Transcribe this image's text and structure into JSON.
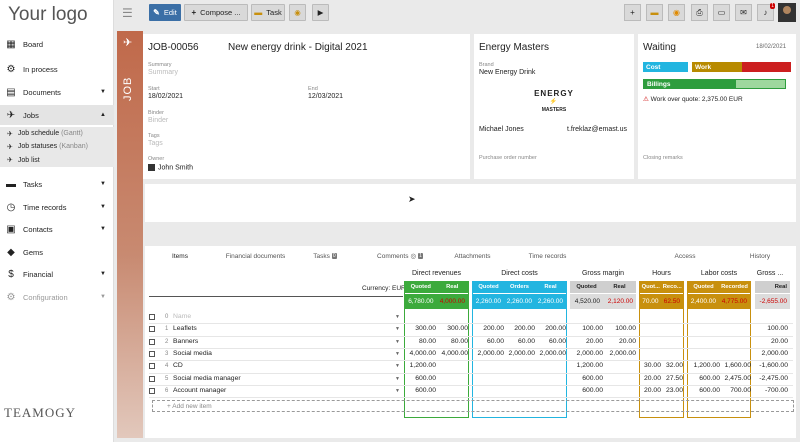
{
  "sidebar": {
    "logo": "Your logo",
    "items": [
      {
        "label": "Board",
        "icon": "grid-icon"
      },
      {
        "label": "In process",
        "icon": "flow-icon"
      },
      {
        "label": "Documents",
        "icon": "document-icon"
      },
      {
        "label": "Jobs",
        "icon": "rocket-icon"
      },
      {
        "label": "Tasks",
        "icon": "tasks-icon"
      },
      {
        "label": "Time records",
        "icon": "clock-icon"
      },
      {
        "label": "Contacts",
        "icon": "contacts-icon"
      },
      {
        "label": "Gems",
        "icon": "gem-icon"
      },
      {
        "label": "Financial",
        "icon": "dollar-icon"
      },
      {
        "label": "Configuration",
        "icon": "gear-icon"
      }
    ],
    "sub": [
      {
        "label": "Job schedule",
        "muted": "(Gantt)"
      },
      {
        "label": "Job statuses",
        "muted": "(Kanban)"
      },
      {
        "label": "Job list",
        "muted": ""
      }
    ],
    "brandmark": "TEAMOGY"
  },
  "toolbar": {
    "edit": "Edit",
    "compose": "Compose ...",
    "task": "Task"
  },
  "job": {
    "strip": "JOB",
    "number": "JOB-00056",
    "name": "New energy drink - Digital 2021",
    "summary_label": "Summary",
    "summary_ph": "Summary",
    "start_label": "Start",
    "start": "18/02/2021",
    "end_label": "End",
    "end": "12/03/2021",
    "binder_label": "Binder",
    "binder_ph": "Binder",
    "tags_label": "Tags",
    "tags_ph": "Tags",
    "owner_label": "Owner",
    "owner": "John Smith"
  },
  "client": {
    "name": "Energy Masters",
    "brand_label": "Brand",
    "brand": "New Energy Drink",
    "logo_top": "ENERGY",
    "logo_bottom": "MASTERS",
    "contact": "Michael Jones",
    "email": "t.freklaz@emast.us",
    "po_label": "Purchase order number"
  },
  "status": {
    "title": "Waiting",
    "date": "18/02/2021",
    "cost": "Cost",
    "work": "Work",
    "billings": "Billings",
    "warning": "Work over quote: 2,375.00 EUR",
    "closing": "Closing remarks"
  },
  "tabs": [
    {
      "label": "Items"
    },
    {
      "label": "Financial documents"
    },
    {
      "label": "Tasks",
      "badge": "0"
    },
    {
      "label": "Comments",
      "badge": "1"
    },
    {
      "label": "Attachments"
    },
    {
      "label": "Time records"
    },
    {
      "label": "Access"
    },
    {
      "label": "History"
    }
  ],
  "table": {
    "currency": "Currency: EUR",
    "groups": [
      "Direct revenues",
      "Direct costs",
      "Gross margin",
      "Hours",
      "Labor costs",
      "Gross ..."
    ],
    "sub": {
      "rev": [
        "Quoted",
        "Real"
      ],
      "cost": [
        "Quoted",
        "Orders",
        "Real"
      ],
      "gm": [
        "Quoted",
        "Real"
      ],
      "hours": [
        "Quot...",
        "Reco..."
      ],
      "labor": [
        "Quoted",
        "Recorded"
      ],
      "gross": [
        "Real"
      ]
    },
    "totals": {
      "rev": [
        "6,780.00",
        "4,000.00"
      ],
      "cost": [
        "2,260.00",
        "2,260.00",
        "2,260.00"
      ],
      "gm": [
        "4,520.00",
        "2,120.00"
      ],
      "hours": [
        "70.00",
        "62.50"
      ],
      "labor": [
        "2,400.00",
        "4,775.00"
      ],
      "gross": [
        "-2,655.00"
      ]
    },
    "rows": [
      {
        "num": "0",
        "name": "Name",
        "ph": true,
        "rev": [
          "",
          ""
        ],
        "cost": [
          "",
          "",
          ""
        ],
        "gm": [
          "",
          ""
        ],
        "hours": [
          "",
          ""
        ],
        "labor": [
          "",
          ""
        ],
        "gross": ""
      },
      {
        "num": "1",
        "name": "Leaflets",
        "rev": [
          "300.00",
          "300.00"
        ],
        "cost": [
          "200.00",
          "200.00",
          "200.00"
        ],
        "gm": [
          "100.00",
          "100.00"
        ],
        "hours": [
          "",
          ""
        ],
        "labor": [
          "",
          ""
        ],
        "gross": "100.00"
      },
      {
        "num": "2",
        "name": "Banners",
        "rev": [
          "80.00",
          "80.00"
        ],
        "cost": [
          "60.00",
          "60.00",
          "60.00"
        ],
        "gm": [
          "20.00",
          "20.00"
        ],
        "hours": [
          "",
          ""
        ],
        "labor": [
          "",
          ""
        ],
        "gross": "20.00"
      },
      {
        "num": "3",
        "name": "Social media",
        "rev": [
          "4,000.00",
          "4,000.00"
        ],
        "cost": [
          "2,000.00",
          "2,000.00",
          "2,000.00"
        ],
        "gm": [
          "2,000.00",
          "2,000.00"
        ],
        "hours": [
          "",
          ""
        ],
        "labor": [
          "",
          ""
        ],
        "gross": "2,000.00"
      },
      {
        "num": "4",
        "name": "CD",
        "rev": [
          "1,200.00",
          ""
        ],
        "cost": [
          "",
          "",
          ""
        ],
        "gm": [
          "1,200.00",
          ""
        ],
        "hours": [
          "30.00",
          "32.00"
        ],
        "labor": [
          "1,200.00",
          "1,600.00"
        ],
        "gross": "-1,600.00"
      },
      {
        "num": "5",
        "name": "Social media manager",
        "rev": [
          "600.00",
          ""
        ],
        "cost": [
          "",
          "",
          ""
        ],
        "gm": [
          "600.00",
          ""
        ],
        "hours": [
          "20.00",
          "27.50"
        ],
        "labor": [
          "600.00",
          "2,475.00"
        ],
        "gross": "-2,475.00"
      },
      {
        "num": "6",
        "name": "Account manager",
        "rev": [
          "600.00",
          ""
        ],
        "cost": [
          "",
          "",
          ""
        ],
        "gm": [
          "600.00",
          ""
        ],
        "hours": [
          "20.00",
          "23.00"
        ],
        "labor": [
          "600.00",
          "700.00"
        ],
        "gross": "-700.00"
      }
    ],
    "add": "+ Add new item"
  },
  "colors": {
    "revenue": "#3caa3c",
    "cost": "#22b5e0",
    "margin": "#cccccc",
    "hours": "#c8900e",
    "labor": "#c8900e",
    "work": "#b88a00",
    "alert": "#cc1f1f",
    "billings": "#2e9d3e"
  }
}
